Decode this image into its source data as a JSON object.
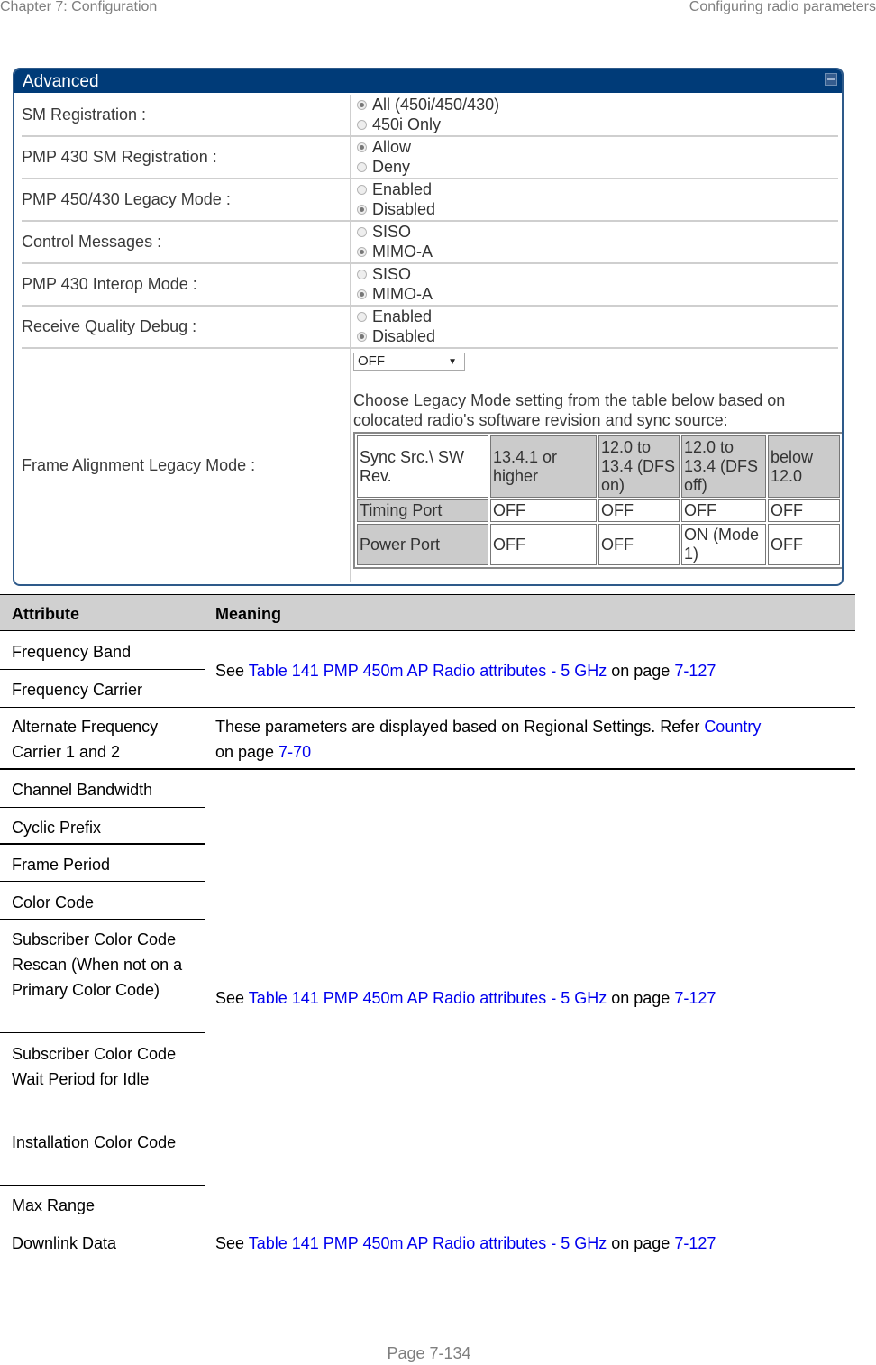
{
  "header": {
    "chapter": "Chapter 7:  Configuration",
    "section": "Configuring radio parameters"
  },
  "panel": {
    "title": "Advanced",
    "collapse_icon": "minimize-icon",
    "fields": [
      {
        "label": "SM Registration :",
        "options": [
          {
            "label": "All (450i/450/430)",
            "selected": true
          },
          {
            "label": "450i Only",
            "selected": false
          }
        ]
      },
      {
        "label": "PMP 430 SM Registration :",
        "options": [
          {
            "label": "Allow",
            "selected": true
          },
          {
            "label": "Deny",
            "selected": false
          }
        ]
      },
      {
        "label": "PMP 450/430 Legacy Mode :",
        "options": [
          {
            "label": "Enabled",
            "selected": false
          },
          {
            "label": "Disabled",
            "selected": true
          }
        ]
      },
      {
        "label": "Control Messages :",
        "options": [
          {
            "label": "SISO",
            "selected": false
          },
          {
            "label": "MIMO-A",
            "selected": true
          }
        ]
      },
      {
        "label": "PMP 430 Interop Mode :",
        "options": [
          {
            "label": "SISO",
            "selected": false
          },
          {
            "label": "MIMO-A",
            "selected": true
          }
        ]
      },
      {
        "label": "Receive Quality Debug :",
        "options": [
          {
            "label": "Enabled",
            "selected": false
          },
          {
            "label": "Disabled",
            "selected": true
          }
        ]
      }
    ],
    "frame_alignment": {
      "label": "Frame Alignment Legacy Mode :",
      "select_value": "OFF",
      "hint": "Choose Legacy Mode setting from the table below based on colocated radio's software revision and sync source:",
      "table": {
        "header": [
          "Sync Src.\\ SW Rev.",
          "13.4.1 or higher",
          "12.0 to 13.4 (DFS on)",
          "12.0 to 13.4 (DFS off)",
          "below 12.0"
        ],
        "rows": [
          [
            "Timing Port",
            "OFF",
            "OFF",
            "OFF",
            "OFF"
          ],
          [
            "Power Port",
            "OFF",
            "OFF",
            "ON (Mode 1)",
            "OFF"
          ]
        ]
      }
    }
  },
  "attributes": {
    "col_attribute": "Attribute",
    "col_meaning": "Meaning",
    "see": "See ",
    "table_ref": "Table 141 PMP 450m AP Radio attributes - 5 GHz",
    "on_page": " on page ",
    "page_ref": "7-127",
    "rows": [
      "Frequency Band",
      "Frequency Carrier",
      "Alternate Frequency Carrier 1 and 2",
      "Channel Bandwidth",
      "Cyclic Prefix",
      "Frame Period",
      "Color Code",
      "Subscriber Color Code Rescan (When not on a Primary Color Code)",
      "Subscriber Color Code Wait Period for Idle",
      "Installation Color Code",
      "Max Range",
      "Downlink Data"
    ],
    "alt_meaning_text": "These parameters are displayed based on Regional Settings. Refer  ",
    "alt_meaning_link": "Country",
    "alt_meaning_on_page": "on page ",
    "alt_meaning_page": "7-70"
  },
  "footer": {
    "page": "Page 7-134"
  }
}
